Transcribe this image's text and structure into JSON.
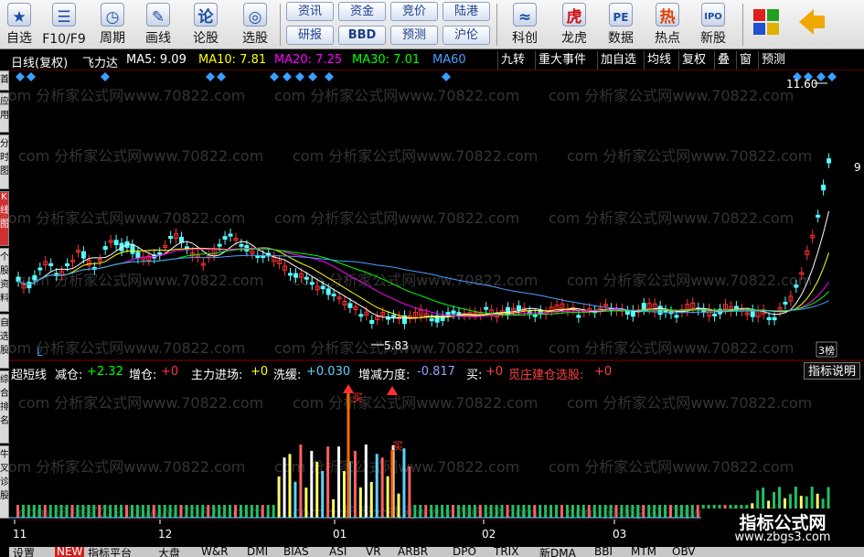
{
  "toolbar": {
    "buttons": [
      {
        "label": "自选",
        "icon": "star-icon",
        "glyph": "★"
      },
      {
        "label": "F10/F9",
        "icon": "f10-icon",
        "glyph": "☰"
      },
      {
        "label": "周期",
        "icon": "clock-icon",
        "glyph": "◷"
      },
      {
        "label": "画线",
        "icon": "pencil-icon",
        "glyph": "✎"
      },
      {
        "label": "论股",
        "icon": "discuss-icon",
        "glyph": "论"
      },
      {
        "label": "选股",
        "icon": "stock-picker-icon",
        "glyph": "◎"
      }
    ],
    "small_buttons_row1": [
      "资讯",
      "资金",
      "竞价",
      "陆港"
    ],
    "small_buttons_row2": [
      "研报",
      "BBD",
      "预测",
      "沪伦"
    ],
    "right_buttons": [
      {
        "label": "科创",
        "icon": "kechuang-icon",
        "glyph": "≈"
      },
      {
        "label": "龙虎",
        "icon": "dragon-tiger-icon",
        "glyph": "虎"
      },
      {
        "label": "数据",
        "icon": "pe-data-icon",
        "glyph": "PE"
      },
      {
        "label": "热点",
        "icon": "hot-icon",
        "glyph": "热"
      },
      {
        "label": "新股",
        "icon": "ipo-icon",
        "glyph": "IPO"
      }
    ],
    "layout_icon": "window-grid-icon",
    "back_icon": "back-arrow-icon"
  },
  "infobar": {
    "period": "日线(复权)",
    "stock_name": "飞力达",
    "ma5": {
      "label": "MA5: 9.09",
      "color": "#ffffff"
    },
    "ma10": {
      "label": "MA10: 7.81",
      "color": "#ffff00"
    },
    "ma20": {
      "label": "MA20: 7.25",
      "color": "#ff00ff"
    },
    "ma30": {
      "label": "MA30: 7.01",
      "color": "#00ff00"
    },
    "ma60": {
      "label": "MA60",
      "color": "#4a9eff"
    },
    "right_buttons": [
      "九转",
      "重大事件",
      "加自选",
      "均线",
      "复权",
      "叠",
      "窗",
      "预测"
    ]
  },
  "left_tabs": [
    "首",
    "应用",
    "分时图",
    "K线图",
    "个股资料",
    "自选股",
    "综合排名",
    "牛叉诊股"
  ],
  "price_chart": {
    "high_label": "11.60",
    "low_label": "5.83",
    "right_axis": [
      "9"
    ],
    "corner_tag": "3榜",
    "up_color": "#ff3232",
    "down_color": "#54ffff"
  },
  "indicator_bar": {
    "name": "超短线",
    "items": [
      {
        "label": "减仓:",
        "value": "+2.32",
        "color": "#00ff00"
      },
      {
        "label": "增仓:",
        "value": "+0",
        "color": "#ff3333"
      },
      {
        "label": "主力进场:",
        "value": "+0",
        "color": "#ffff00"
      },
      {
        "label": "洗缓:",
        "value": "+0.030",
        "color": "#5ad2ff"
      },
      {
        "label": "增减力度:",
        "value": "-0.817",
        "color": "#9b9bff"
      },
      {
        "label": "买:",
        "value": "+0",
        "color": "#ff4040"
      },
      {
        "label": "觅庄建仓选股:",
        "value": "+0",
        "color": "#ff4040"
      }
    ],
    "help_button": "指标说明"
  },
  "signals": {
    "buy_label": "买"
  },
  "x_axis": [
    "11",
    "12",
    "01",
    "02",
    "03"
  ],
  "bottom_tabs": [
    "设置",
    "NEW",
    "指标平台",
    "大盘",
    "W&R",
    "DMI",
    "BIAS",
    "ASI",
    "VR",
    "ARBR",
    "DPO",
    "TRIX",
    "新DMA",
    "BBI",
    "MTM",
    "OBV"
  ],
  "watermark": "com 分析家公式网www.70822.com",
  "badge": {
    "title": "指标公式网",
    "url": "www.zbgs3.com"
  }
}
